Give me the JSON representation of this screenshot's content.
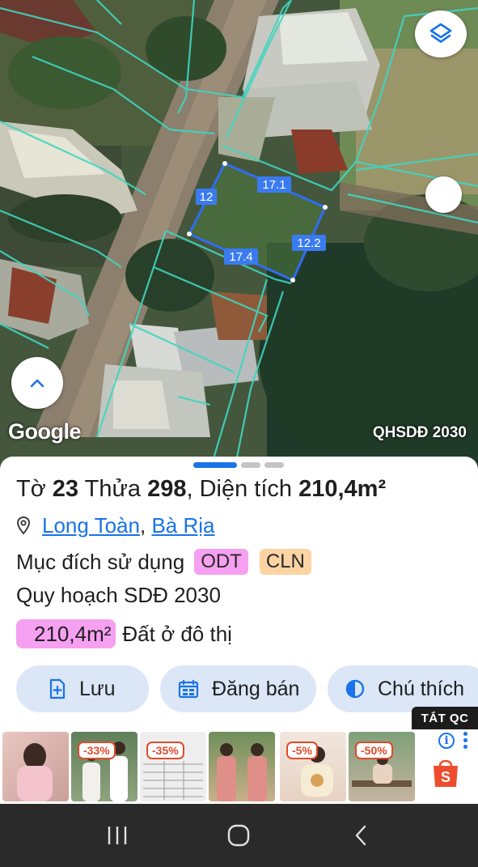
{
  "map": {
    "attribution": "Google",
    "layer_label": "QHSDĐ 2030",
    "plot_edges": [
      "17.1",
      "12.2",
      "17.4",
      "12"
    ],
    "colors": {
      "boundary": "#3fd6c0",
      "plot": "#2f6df2"
    }
  },
  "controls": {
    "layers_icon": "layers-icon",
    "compass_icon": "compass-icon",
    "expand_icon": "chevron-up-icon"
  },
  "parcel": {
    "sheet_label": "Tờ",
    "sheet_no": "23",
    "plot_label": "Thửa",
    "plot_no": "298",
    "area_label": "Diện tích",
    "area_value": "210,4m²",
    "ward": "Long Toàn",
    "separator": ",",
    "city": "Bà Rịa",
    "purpose_label": "Mục đích sử dụng",
    "purpose_tags": [
      "ODT",
      "CLN"
    ],
    "plan_label": "Quy hoạch SDĐ 2030",
    "zone_area": "210,4m²",
    "zone_label": "Đất ở đô thị"
  },
  "actions": {
    "save": "Lưu",
    "sell": "Đăng bán",
    "legend": "Chú thích"
  },
  "ad": {
    "close_label": "TẮT QC",
    "discounts": [
      "-33%",
      "-35%",
      "-5%",
      "-50%"
    ],
    "info_icon": "info-icon",
    "shop_icon": "shopping-bag-icon"
  },
  "nav": {
    "recents_icon": "recents-icon",
    "home_icon": "home-icon",
    "back_icon": "back-icon"
  },
  "colors": {
    "accent": "#1a73e8",
    "tag_odt": "#f6a0f1",
    "tag_cln": "#fcd4a4",
    "action_bg": "#dbe6f7"
  }
}
